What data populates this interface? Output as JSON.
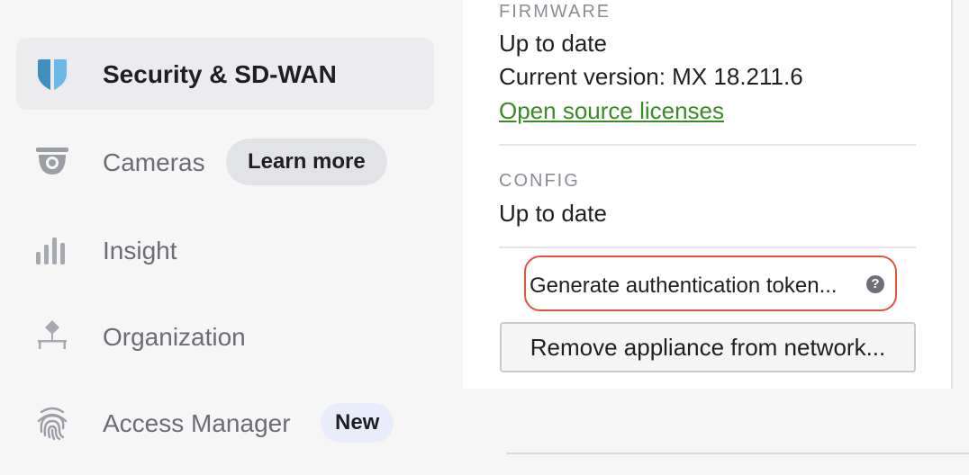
{
  "sidebar": {
    "items": [
      {
        "label": "Security & SD-WAN",
        "icon": "shield-icon",
        "active": true
      },
      {
        "label": "Cameras",
        "icon": "camera-icon",
        "active": false,
        "badge": "Learn more"
      },
      {
        "label": "Insight",
        "icon": "bar-chart-icon",
        "active": false
      },
      {
        "label": "Organization",
        "icon": "organization-icon",
        "active": false
      },
      {
        "label": "Access Manager",
        "icon": "fingerprint-icon",
        "active": false,
        "badge": "New"
      }
    ]
  },
  "panel": {
    "firmware": {
      "label": "FIRMWARE",
      "status": "Up to date",
      "version": "Current version: MX 18.211.6",
      "licenses_link": "Open source licenses"
    },
    "config": {
      "label": "CONFIG",
      "status": "Up to date"
    },
    "generate_token": "Generate authentication token...",
    "help_glyph": "?",
    "remove_button": "Remove appliance from network..."
  },
  "colors": {
    "link": "#3a8a26",
    "highlight": "#e0553a",
    "shield_primary": "#3f8fc1",
    "shield_secondary": "#6bb9e6"
  }
}
